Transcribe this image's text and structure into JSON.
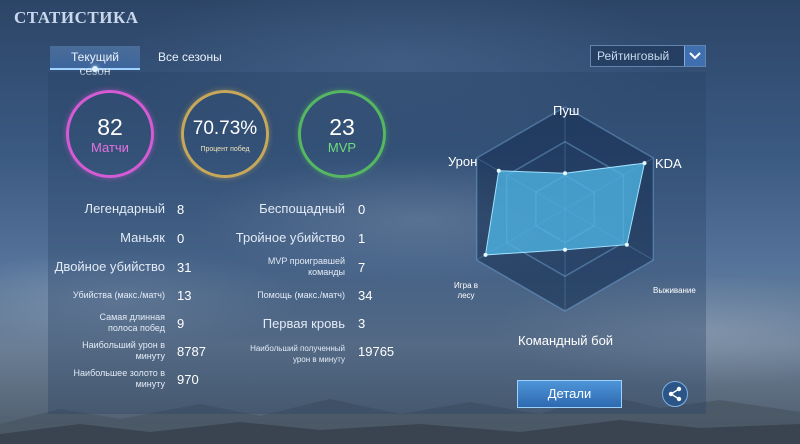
{
  "title": "СТАТИСТИКА",
  "tabs": [
    {
      "label": "Текущий сезон",
      "active": true
    },
    {
      "label": "Все сезоны",
      "active": false
    }
  ],
  "mode_select": {
    "value": "Рейтинговый"
  },
  "summary": {
    "matches": {
      "value": "82",
      "label": "Матчи",
      "color": "#d45bd3"
    },
    "win_rate": {
      "value": "70.73%",
      "label": "Процент побед",
      "color": "#c7a85a"
    },
    "mvp": {
      "value": "23",
      "label": "MVP",
      "color": "#55b761"
    }
  },
  "stats_left": [
    {
      "label": "Легендарный",
      "value": "8"
    },
    {
      "label": "Маньяк",
      "value": "0"
    },
    {
      "label": "Двойное убийство",
      "value": "31"
    },
    {
      "label": "Убийства (макс./матч)",
      "value": "13"
    },
    {
      "label": "Самая длинная полоса побед",
      "value": "9"
    },
    {
      "label": "Наибольший урон в минуту",
      "value": "8787"
    },
    {
      "label": "Наибольшее золото в минуту",
      "value": "970"
    }
  ],
  "stats_right": [
    {
      "label": "Беспощадный",
      "value": "0"
    },
    {
      "label": "Тройное убийство",
      "value": "1"
    },
    {
      "label": "MVP проигравшей команды",
      "value": "7"
    },
    {
      "label": "Помощь (макс./матч)",
      "value": "34"
    },
    {
      "label": "Первая кровь",
      "value": "3"
    },
    {
      "label": "Наибольший полученный урон в минуту",
      "value": "19765"
    }
  ],
  "radar": {
    "axes": [
      "Пуш",
      "KDA",
      "Выживание",
      "Командный бой",
      "Игра в лесу",
      "Урон"
    ],
    "values": [
      0.35,
      0.9,
      0.7,
      0.4,
      0.9,
      0.75
    ],
    "fill_color": "#4fb6e6"
  },
  "details_button": {
    "label": "Детали"
  },
  "share_icon": "share-icon"
}
